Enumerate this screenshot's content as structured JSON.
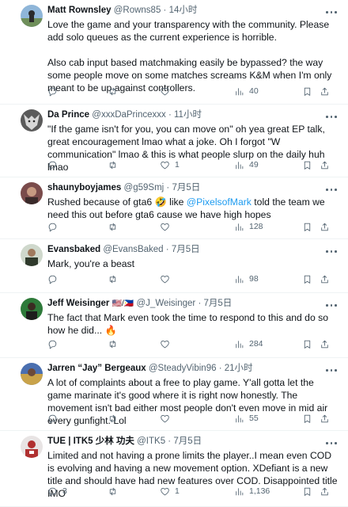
{
  "tweets": [
    {
      "name": "Matt Rownsley",
      "handle": "@Rowns85",
      "time": "14小时",
      "paragraphs": [
        "Love the game and your transparency with the community. Please add solo queues as the current experience is horrible.",
        "Also cab input based matchmaking easily be bypassed? the way some people move on some matches screams K&M when I'm only meant to be up against controllers."
      ],
      "replies": "",
      "retweets": "",
      "likes": "",
      "views": "40"
    },
    {
      "name": "Da Prince",
      "handle": "@xxxDaPrincexxx",
      "time": "11小时",
      "paragraphs": [
        "\"If the game isn't for you, you can move on\" oh yea great EP talk, great encouragement lmao what a joke. Oh I forgot \"W communication\" lmao & this is what people slurp on the daily huh lmao"
      ],
      "replies": "",
      "retweets": "",
      "likes": "1",
      "views": "49"
    },
    {
      "name": "shaunyboyjames",
      "handle": "@g59Smj",
      "time": "7月5日",
      "text_before": "Rushed because of gta6 🤣 like ",
      "mention": "@PixelsofMark",
      "text_after": " told the team we need this out before gta6 cause we have high hopes",
      "replies": "",
      "retweets": "",
      "likes": "",
      "views": "128"
    },
    {
      "name": "Evansbaked",
      "handle": "@EvansBaked",
      "time": "7月5日",
      "paragraphs": [
        "Mark, you're a beast"
      ],
      "replies": "",
      "retweets": "",
      "likes": "",
      "views": "98"
    },
    {
      "name": "Jeff Weisinger",
      "flags": "🇺🇸/🇵🇭",
      "handle": "@J_Weisinger",
      "time": "7月5日",
      "paragraphs": [
        "The fact that Mark even took the time to respond to this and do so how he did... 🔥"
      ],
      "replies": "",
      "retweets": "",
      "likes": "",
      "views": "284"
    },
    {
      "name": "Jarren “Jay” Bergeaux",
      "handle": "@SteadyVibin96",
      "time": "21小时",
      "paragraphs": [
        "A lot of complaints about a free to play game. Y'all gotta let the game marinate it's good where it is right now honestly. The movement isn't bad either most people don't even move in mid air every gunfight. Lol"
      ],
      "replies": "",
      "retweets": "",
      "likes": "",
      "views": "55"
    },
    {
      "name": "TUE | ITK5 少林 功夫",
      "handle": "@ITK5",
      "time": "7月5日",
      "paragraphs": [
        "Limited and not having a prone limits the player..I mean even COD is evolving and having a new movement option. XDefiant is a new title and should have had new features over COD. Disappointed title IMO"
      ],
      "replies": "3",
      "retweets": "",
      "likes": "1",
      "views": "1,136"
    }
  ],
  "colors": {
    "text": "#0f1419",
    "muted": "#536471",
    "link": "#1d9bf0",
    "divider": "#eff3f4"
  }
}
